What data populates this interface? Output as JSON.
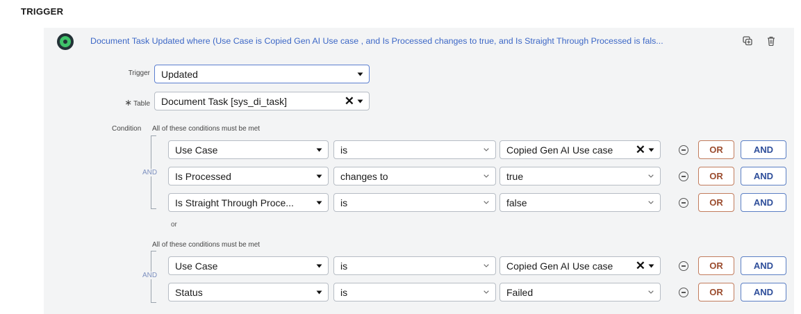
{
  "section_title": "TRIGGER",
  "summary": "Document Task Updated where (Use Case is Copied Gen AI Use case , and Is Processed changes to true, and Is Straight Through Processed is fals...",
  "icons": {
    "status": "status-dot-icon",
    "duplicate": "duplicate-icon",
    "delete": "trash-icon"
  },
  "colors": {
    "accent": "#3c67c6",
    "or": "#9b4c2e",
    "and": "#2e4e9a",
    "status_green": "#3fc46a"
  },
  "trigger": {
    "label": "Trigger",
    "value": "Updated"
  },
  "table": {
    "required_mark": "∗",
    "label": "Table",
    "value": "Document Task [sys_di_task]"
  },
  "condition": {
    "label": "Condition"
  },
  "groups": [
    {
      "title": "All of these conditions must be met",
      "join": "AND",
      "rows": [
        {
          "field": "Use Case",
          "operator": "is",
          "value": "Copied Gen AI Use case",
          "value_clearable": true
        },
        {
          "field": "Is Processed",
          "operator": "changes to",
          "value": "true",
          "value_clearable": false
        },
        {
          "field": "Is Straight Through Proce...",
          "operator": "is",
          "value": "false",
          "value_clearable": false
        }
      ],
      "after": "or"
    },
    {
      "title": "All of these conditions must be met",
      "join": "AND",
      "rows": [
        {
          "field": "Use Case",
          "operator": "is",
          "value": "Copied Gen AI Use case",
          "value_clearable": true
        },
        {
          "field": "Status",
          "operator": "is",
          "value": "Failed",
          "value_clearable": false
        }
      ]
    }
  ],
  "row_buttons": {
    "or": "OR",
    "and": "AND"
  }
}
